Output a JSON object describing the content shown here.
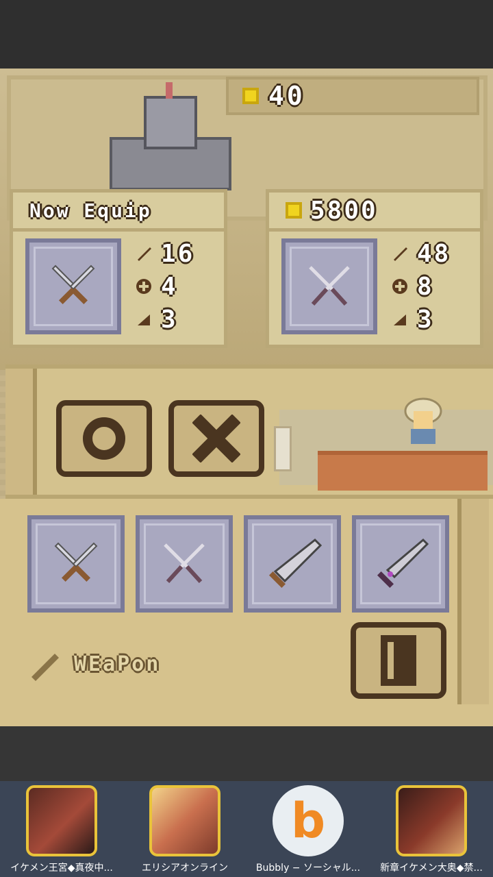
{
  "header": {
    "gold": "40"
  },
  "now_equip": {
    "title": "Now Equip",
    "stats": {
      "attack": "16",
      "defense": "4",
      "level": "3"
    },
    "weapon_icon": "crossed-swords-icon"
  },
  "shop_item": {
    "price": "5800",
    "stats": {
      "attack": "48",
      "defense": "8",
      "level": "3"
    },
    "weapon_icon": "crossed-swords-dark-icon"
  },
  "buttons": {
    "confirm": "O",
    "cancel": "X"
  },
  "inventory": {
    "slots": [
      "crossed-swords-icon",
      "crossed-swords-dark-icon",
      "broad-sword-icon",
      "dark-sword-icon"
    ]
  },
  "tab": {
    "label": "WEaPon"
  },
  "ads": [
    {
      "label": "イケメン王宮◆真夜中..."
    },
    {
      "label": "エリシアオンライン"
    },
    {
      "label": "Bubbly − ソーシャル..."
    },
    {
      "label": "新章イケメン大奥◆禁..."
    }
  ],
  "colors": {
    "gold": "#f0d420",
    "slot": "#a9a8c0",
    "outline": "#3c2b18"
  }
}
